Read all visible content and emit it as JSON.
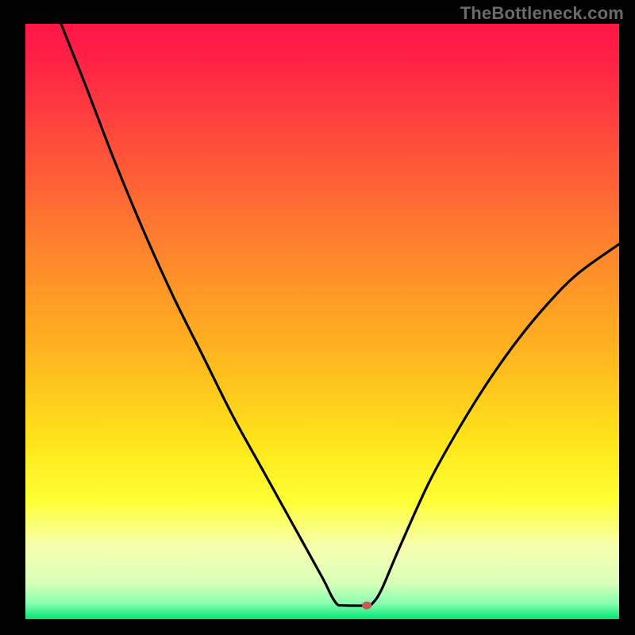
{
  "watermark": "TheBottleneck.com",
  "chart_data": {
    "type": "line",
    "title": "",
    "xlabel": "",
    "ylabel": "",
    "xlim": [
      0,
      100
    ],
    "ylim": [
      0,
      100
    ],
    "background_gradient": {
      "stops": [
        {
          "offset": 0.0,
          "color": "#ff1744"
        },
        {
          "offset": 0.05,
          "color": "#ff1e46"
        },
        {
          "offset": 0.2,
          "color": "#ff4d3a"
        },
        {
          "offset": 0.4,
          "color": "#ff8a2a"
        },
        {
          "offset": 0.55,
          "color": "#ffb41f"
        },
        {
          "offset": 0.7,
          "color": "#ffe41a"
        },
        {
          "offset": 0.8,
          "color": "#ffff33"
        },
        {
          "offset": 0.88,
          "color": "#f6ffb0"
        },
        {
          "offset": 0.94,
          "color": "#d7ffb8"
        },
        {
          "offset": 0.973,
          "color": "#8affb0"
        },
        {
          "offset": 1.0,
          "color": "#00e676"
        }
      ]
    },
    "series": [
      {
        "name": "bottleneck-curve",
        "color": "#000000",
        "width": 3.2,
        "points": [
          {
            "x": 6.0,
            "y": 100.0
          },
          {
            "x": 10.0,
            "y": 90.0
          },
          {
            "x": 15.0,
            "y": 77.0
          },
          {
            "x": 20.0,
            "y": 65.0
          },
          {
            "x": 25.0,
            "y": 54.0
          },
          {
            "x": 30.0,
            "y": 44.0
          },
          {
            "x": 35.0,
            "y": 34.0
          },
          {
            "x": 40.0,
            "y": 25.0
          },
          {
            "x": 45.0,
            "y": 16.0
          },
          {
            "x": 50.0,
            "y": 7.0
          },
          {
            "x": 51.5,
            "y": 4.0
          },
          {
            "x": 52.5,
            "y": 2.5
          },
          {
            "x": 53.5,
            "y": 2.3
          },
          {
            "x": 57.5,
            "y": 2.3
          },
          {
            "x": 58.5,
            "y": 2.7
          },
          {
            "x": 60.0,
            "y": 5.0
          },
          {
            "x": 63.0,
            "y": 12.0
          },
          {
            "x": 68.0,
            "y": 23.0
          },
          {
            "x": 73.0,
            "y": 32.0
          },
          {
            "x": 78.0,
            "y": 40.0
          },
          {
            "x": 83.0,
            "y": 47.0
          },
          {
            "x": 88.0,
            "y": 53.0
          },
          {
            "x": 93.0,
            "y": 58.0
          },
          {
            "x": 100.0,
            "y": 63.0
          }
        ]
      }
    ],
    "marker": {
      "x": 57.5,
      "y": 2.3,
      "rx": 6,
      "ry": 5,
      "color": "#c85a54"
    }
  }
}
